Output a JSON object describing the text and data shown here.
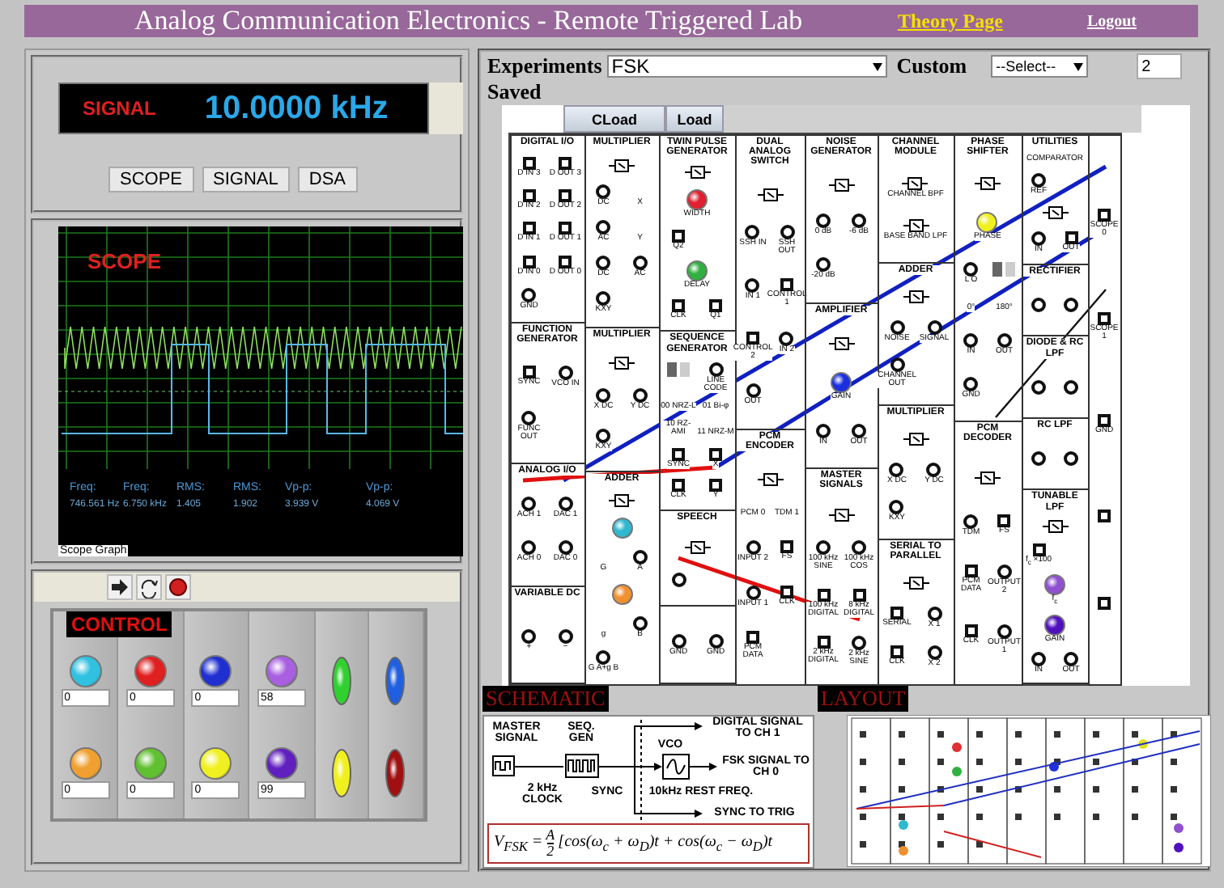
{
  "header": {
    "title": "Analog Communication Electronics - Remote Triggered Lab",
    "theory_link": "Theory Page",
    "logout_link": "Logout"
  },
  "signal": {
    "label": "SIGNAL",
    "value": "10.0000 kHz",
    "buttons": [
      "SCOPE",
      "SIGNAL",
      "DSA"
    ]
  },
  "scope": {
    "title": "SCOPE",
    "graph_label": "Scope Graph",
    "readings": [
      {
        "label": "Freq:",
        "value": "746.561 Hz"
      },
      {
        "label": "Freq:",
        "value": "6.750 kHz"
      },
      {
        "label": "RMS:",
        "value": "1.405"
      },
      {
        "label": "RMS:",
        "value": "1.902"
      },
      {
        "label": "Vp-p:",
        "value": "3.939 V"
      },
      {
        "label": "Vp-p:",
        "value": "4.069 V"
      }
    ]
  },
  "control": {
    "title": "CONTROL",
    "knobs": [
      {
        "color": "#30c0e0",
        "value": "0"
      },
      {
        "color": "#e02020",
        "value": "0"
      },
      {
        "color": "#2030d0",
        "value": "0"
      },
      {
        "color": "#a860e0",
        "value": "58"
      },
      {
        "color": "#f0a030",
        "value": "0"
      },
      {
        "color": "#60c030",
        "value": "0"
      },
      {
        "color": "#f0f020",
        "value": "0"
      },
      {
        "color": "#6020c0",
        "value": "99"
      }
    ],
    "leds": [
      {
        "color": "#30d030"
      },
      {
        "color": "#2060e0"
      },
      {
        "color": "#f0f020"
      },
      {
        "color": "#a01010"
      }
    ]
  },
  "experiments": {
    "label": "Experiments",
    "value": "FSK",
    "custom_label": "Custom",
    "saved_label": "Saved",
    "saved_select": "--Select--",
    "count": "2",
    "buttons": [
      "CLoad",
      "Load"
    ]
  },
  "board": {
    "columns": [
      {
        "modules": [
          {
            "title": "DIGITAL I/O",
            "items": [
              {
                "kind": "square",
                "label": "D IN 3"
              },
              {
                "kind": "square",
                "label": "D OUT 3"
              },
              {
                "kind": "square",
                "label": "D IN 2"
              },
              {
                "kind": "square",
                "label": "D OUT 2"
              },
              {
                "kind": "square",
                "label": "D IN 1"
              },
              {
                "kind": "square",
                "label": "D OUT 1"
              },
              {
                "kind": "square",
                "label": "D IN 0"
              },
              {
                "kind": "square",
                "label": "D OUT 0"
              },
              {
                "kind": "round",
                "label": "GND"
              }
            ]
          },
          {
            "title": "FUNCTION GENERATOR",
            "items": [
              {
                "kind": "square",
                "label": "SYNC"
              },
              {
                "kind": "round",
                "label": "VCO IN"
              },
              {
                "kind": "round",
                "label": "FUNC OUT"
              }
            ]
          },
          {
            "title": "ANALOG I/O",
            "items": [
              {
                "kind": "round",
                "label": "ACH 1"
              },
              {
                "kind": "round",
                "label": "DAC 1"
              },
              {
                "kind": "round",
                "label": "ACH 0"
              },
              {
                "kind": "round",
                "label": "DAC 0"
              }
            ]
          },
          {
            "title": "VARIABLE DC",
            "items": [
              {
                "kind": "round",
                "label": "+"
              },
              {
                "kind": "round",
                "label": "−"
              }
            ]
          }
        ]
      },
      {
        "modules": [
          {
            "title": "MULTIPLIER",
            "items": [
              {
                "kind": "symbol"
              },
              {
                "kind": "round",
                "label": "DC"
              },
              {
                "kind": "text",
                "label": "X"
              },
              {
                "kind": "round",
                "label": "AC"
              },
              {
                "kind": "text",
                "label": "Y"
              },
              {
                "kind": "round",
                "label": "DC"
              },
              {
                "kind": "round",
                "label": "AC"
              },
              {
                "kind": "round",
                "label": "KXY"
              }
            ]
          },
          {
            "title": "MULTIPLIER",
            "items": [
              {
                "kind": "symbol"
              },
              {
                "kind": "round",
                "label": "X DC"
              },
              {
                "kind": "round",
                "label": "Y DC"
              },
              {
                "kind": "round",
                "label": "KXY"
              }
            ]
          },
          {
            "title": "ADDER",
            "items": [
              {
                "kind": "symbol"
              },
              {
                "kind": "knob",
                "color": "#30b8d0"
              },
              {
                "kind": "text",
                "label": "G"
              },
              {
                "kind": "round",
                "label": "A"
              },
              {
                "kind": "knob",
                "color": "#f09030"
              },
              {
                "kind": "text",
                "label": "g"
              },
              {
                "kind": "round",
                "label": "B"
              },
              {
                "kind": "round",
                "label": "G A+g B"
              }
            ]
          }
        ]
      },
      {
        "modules": [
          {
            "title": "TWIN PULSE GENERATOR",
            "items": [
              {
                "kind": "symbol"
              },
              {
                "kind": "knob",
                "color": "#e02030",
                "label": "WIDTH"
              },
              {
                "kind": "square",
                "label": "Q2"
              },
              {
                "kind": "knob",
                "color": "#30b040",
                "label": "DELAY"
              },
              {
                "kind": "square",
                "label": "CLK"
              },
              {
                "kind": "square",
                "label": "Q1"
              }
            ]
          },
          {
            "title": "SEQUENCE GENERATOR",
            "items": [
              {
                "kind": "switch",
                "on": false
              },
              {
                "kind": "round",
                "label": "LINE CODE"
              },
              {
                "kind": "text",
                "label": "00 NRZ-L"
              },
              {
                "kind": "text",
                "label": "01 Bi-φ"
              },
              {
                "kind": "text",
                "label": "10 RZ-AMI"
              },
              {
                "kind": "text",
                "label": "11 NRZ-M"
              },
              {
                "kind": "square",
                "label": "SYNC"
              },
              {
                "kind": "square",
                "label": "X"
              },
              {
                "kind": "square",
                "label": "CLK"
              },
              {
                "kind": "square",
                "label": "Y"
              }
            ]
          },
          {
            "title": "SPEECH",
            "items": [
              {
                "kind": "symbol"
              },
              {
                "kind": "round"
              }
            ]
          },
          {
            "items": [
              {
                "kind": "round",
                "label": "GND"
              },
              {
                "kind": "round",
                "label": "GND"
              }
            ]
          }
        ]
      },
      {
        "modules": [
          {
            "title": "DUAL ANALOG SWITCH",
            "items": [
              {
                "kind": "symbol"
              },
              {
                "kind": "round",
                "label": "SSH IN"
              },
              {
                "kind": "round",
                "label": "SSH OUT"
              },
              {
                "kind": "round",
                "label": "IN 1"
              },
              {
                "kind": "square",
                "label": "CONTROL 1"
              },
              {
                "kind": "square",
                "label": "CONTROL 2"
              },
              {
                "kind": "round",
                "label": "IN 2"
              },
              {
                "kind": "round",
                "label": "OUT"
              }
            ]
          },
          {
            "title": "PCM ENCODER",
            "items": [
              {
                "kind": "symbol"
              },
              {
                "kind": "text",
                "label": "PCM 0"
              },
              {
                "kind": "text",
                "label": "TDM 1"
              },
              {
                "kind": "round",
                "label": "INPUT 2"
              },
              {
                "kind": "square",
                "label": "FS"
              },
              {
                "kind": "round",
                "label": "INPUT 1"
              },
              {
                "kind": "square",
                "label": "CLK"
              },
              {
                "kind": "square",
                "label": "PCM DATA"
              }
            ]
          }
        ]
      },
      {
        "modules": [
          {
            "title": "NOISE GENERATOR",
            "items": [
              {
                "kind": "symbol"
              },
              {
                "kind": "round",
                "label": "0 dB"
              },
              {
                "kind": "round",
                "label": "-6 dB"
              },
              {
                "kind": "round",
                "label": "-20 dB"
              }
            ]
          },
          {
            "title": "AMPLIFIER",
            "items": [
              {
                "kind": "symbol"
              },
              {
                "kind": "knob",
                "color": "#1a30e0",
                "label": "GAIN"
              },
              {
                "kind": "round",
                "label": "IN"
              },
              {
                "kind": "round",
                "label": "OUT"
              }
            ]
          },
          {
            "title": "MASTER SIGNALS",
            "items": [
              {
                "kind": "symbol"
              },
              {
                "kind": "round",
                "label": "100 kHz SINE"
              },
              {
                "kind": "round",
                "label": "100 kHz COS"
              },
              {
                "kind": "square",
                "label": "100 kHz DIGITAL"
              },
              {
                "kind": "square",
                "label": "8 kHz DIGITAL"
              },
              {
                "kind": "square",
                "label": "2 kHz DIGITAL"
              },
              {
                "kind": "round",
                "label": "2 kHz SINE"
              }
            ]
          }
        ]
      },
      {
        "modules": [
          {
            "title": "CHANNEL MODULE",
            "items": [
              {
                "kind": "symbol",
                "label": "CHANNEL BPF"
              },
              {
                "kind": "symbol",
                "label": "BASE BAND LPF"
              }
            ]
          },
          {
            "title": "ADDER",
            "items": [
              {
                "kind": "symbol"
              },
              {
                "kind": "round",
                "label": "NOISE"
              },
              {
                "kind": "round",
                "label": "SIGNAL"
              },
              {
                "kind": "round",
                "label": "CHANNEL OUT"
              }
            ]
          },
          {
            "title": "MULTIPLIER",
            "items": [
              {
                "kind": "symbol"
              },
              {
                "kind": "round",
                "label": "X DC"
              },
              {
                "kind": "round",
                "label": "Y DC"
              },
              {
                "kind": "round",
                "label": "KXY"
              }
            ]
          },
          {
            "title": "SERIAL TO PARALLEL",
            "items": [
              {
                "kind": "symbol"
              },
              {
                "kind": "square",
                "label": "SERIAL"
              },
              {
                "kind": "round",
                "label": "X 1"
              },
              {
                "kind": "square",
                "label": "CLK"
              },
              {
                "kind": "round",
                "label": "X 2"
              }
            ]
          }
        ]
      },
      {
        "modules": [
          {
            "title": "PHASE SHIFTER",
            "items": [
              {
                "kind": "symbol"
              },
              {
                "kind": "knob",
                "color": "#f0f020",
                "label": "PHASE"
              },
              {
                "kind": "round",
                "label": "L O"
              },
              {
                "kind": "switch",
                "on": false
              },
              {
                "kind": "text",
                "label": "0°"
              },
              {
                "kind": "text",
                "label": "180°"
              },
              {
                "kind": "round",
                "label": "IN"
              },
              {
                "kind": "round",
                "label": "OUT"
              },
              {
                "kind": "round",
                "label": "GND"
              }
            ]
          },
          {
            "title": "PCM DECODER",
            "items": [
              {
                "kind": "symbol"
              },
              {
                "kind": "round",
                "label": "TDM"
              },
              {
                "kind": "square",
                "label": "FS"
              },
              {
                "kind": "square",
                "label": "PCM DATA"
              },
              {
                "kind": "round",
                "label": "OUTPUT 2"
              },
              {
                "kind": "square",
                "label": "CLK"
              },
              {
                "kind": "round",
                "label": "OUTPUT 1"
              }
            ]
          }
        ]
      },
      {
        "modules": [
          {
            "title": "UTILITIES",
            "items": [
              {
                "kind": "heading",
                "label": "COMPARATOR"
              },
              {
                "kind": "round",
                "label": "REF"
              },
              {
                "kind": "symbol"
              },
              {
                "kind": "round",
                "label": "IN"
              },
              {
                "kind": "square",
                "label": "OUT"
              }
            ]
          },
          {
            "title": "RECTIFIER",
            "items": [
              {
                "kind": "round"
              },
              {
                "kind": "round"
              }
            ]
          },
          {
            "title": "DIODE & RC LPF",
            "items": [
              {
                "kind": "round"
              },
              {
                "kind": "round"
              }
            ]
          },
          {
            "title": "RC LPF",
            "items": [
              {
                "kind": "round"
              },
              {
                "kind": "round"
              }
            ]
          },
          {
            "title": "TUNABLE LPF",
            "items": [
              {
                "kind": "symbol"
              },
              {
                "kind": "square",
                "label": "f$_{c}$ ×100"
              },
              {
                "kind": "knob",
                "color": "#9050d0",
                "label": "f$_{c}$"
              },
              {
                "kind": "knob",
                "color": "#5010c0",
                "label": "GAIN"
              },
              {
                "kind": "round",
                "label": "IN"
              },
              {
                "kind": "round",
                "label": "OUT"
              }
            ]
          }
        ]
      },
      {
        "modules": [
          {
            "items": [
              {
                "kind": "square",
                "label": "SCOPE 0"
              },
              {
                "kind": "square",
                "label": "SCOPE 1"
              },
              {
                "kind": "square",
                "label": "GND"
              },
              {
                "kind": "square"
              },
              {
                "kind": "square"
              }
            ]
          }
        ]
      }
    ]
  },
  "schematic": {
    "title": "SCHEMATIC",
    "master_signal": "MASTER SIGNAL",
    "seq_gen": "SEQ. GEN",
    "clock": "2 kHz CLOCK",
    "sync": "SYNC",
    "vco": "VCO",
    "rest_freq": "10kHz REST FREQ.",
    "digital_out": "DIGITAL SIGNAL TO CH 1",
    "fsk_out": "FSK SIGNAL TO CH 0",
    "sync_out": "SYNC TO TRIG",
    "formula": {
      "lhs": "V$_{FSK}$ =",
      "numerator": "A",
      "denominator": "2",
      "rhs": "[cos(ω$_{c}$ + ω$_{D}$)t + cos(ω$_{c}$ − ω$_{D}$)t"
    }
  },
  "layout": {
    "title": "LAYOUT"
  }
}
